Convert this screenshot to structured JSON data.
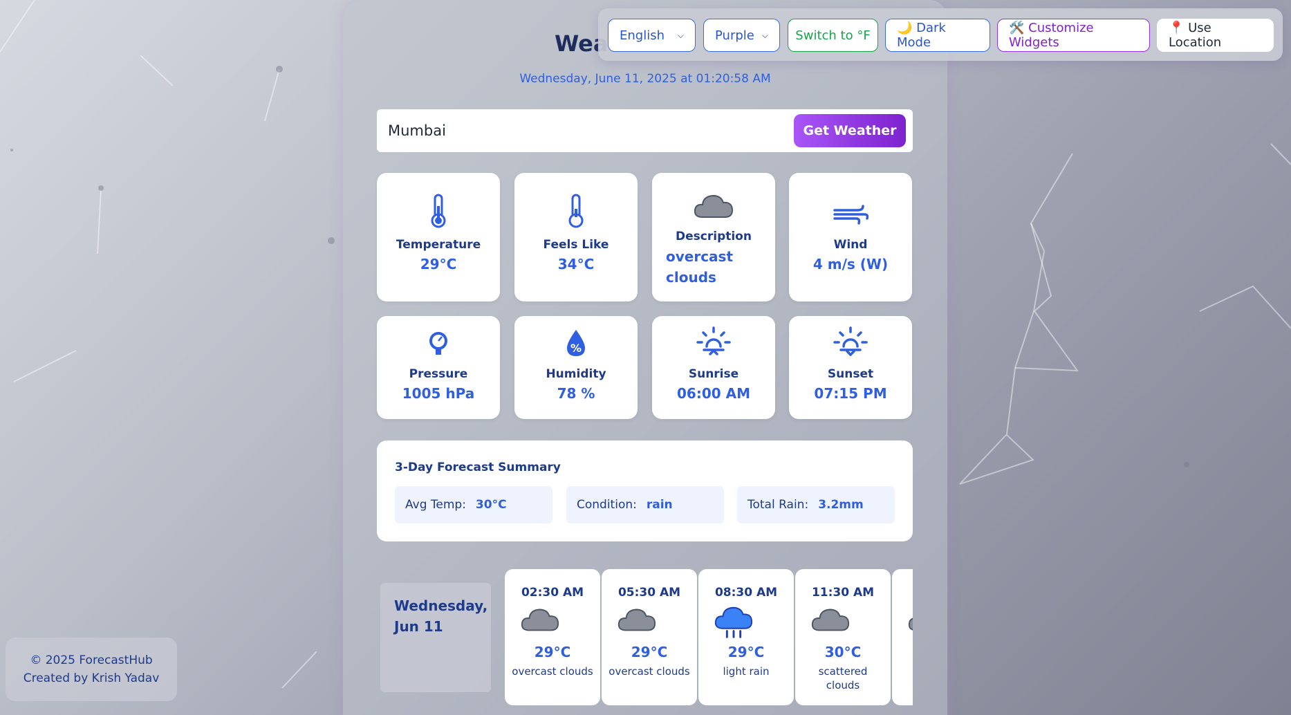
{
  "app": {
    "title": "Weather"
  },
  "toolbar": {
    "language": "English",
    "theme": "Purple",
    "unit_toggle": "Switch to °F",
    "dark_mode": "🌙 Dark Mode",
    "customize": "🛠️ Customize Widgets",
    "location": "📍 Use Location"
  },
  "datetime": "Wednesday, June 11, 2025 at 01:20:58 AM",
  "search": {
    "value": "Mumbai",
    "button": "Get Weather"
  },
  "tiles": {
    "temperature": {
      "label": "Temperature",
      "value": "29°C",
      "icon": "thermometer-icon"
    },
    "feels_like": {
      "label": "Feels Like",
      "value": "34°C",
      "icon": "thermometer-icon"
    },
    "description": {
      "label": "Description",
      "value": "overcast clouds",
      "icon": "cloud-icon"
    },
    "wind": {
      "label": "Wind",
      "value": "4 m/s (W)",
      "icon": "wind-icon"
    },
    "pressure": {
      "label": "Pressure",
      "value": "1005 hPa",
      "icon": "gauge-icon"
    },
    "humidity": {
      "label": "Humidity",
      "value": "78 %",
      "icon": "humidity-drop-icon"
    },
    "sunrise": {
      "label": "Sunrise",
      "value": "06:00 AM",
      "icon": "sunrise-icon"
    },
    "sunset": {
      "label": "Sunset",
      "value": "07:15 PM",
      "icon": "sunset-icon"
    }
  },
  "summary": {
    "title": "3-Day Forecast Summary",
    "avg_temp_label": "Avg Temp:",
    "avg_temp_value": "30°C",
    "condition_label": "Condition:",
    "condition_value": "rain",
    "rain_label": "Total Rain:",
    "rain_value": "3.2mm"
  },
  "hourly": {
    "day": "Wednesday, Jun 11",
    "items": [
      {
        "time": "02:30 AM",
        "temp": "29°C",
        "desc": "overcast clouds",
        "icon": "cloud-icon"
      },
      {
        "time": "05:30 AM",
        "temp": "29°C",
        "desc": "overcast clouds",
        "icon": "cloud-icon"
      },
      {
        "time": "08:30 AM",
        "temp": "29°C",
        "desc": "light rain",
        "icon": "rain-cloud-icon"
      },
      {
        "time": "11:30 AM",
        "temp": "30°C",
        "desc": "scattered clouds",
        "icon": "cloud-icon"
      }
    ]
  },
  "footer": {
    "copyright": "© 2025 ForecastHub",
    "credit": "Created by Krish Yadav"
  },
  "colors": {
    "accent": "#2f5fe0",
    "brand_purple": "#7e22ce",
    "heading": "#1e3a8a"
  }
}
